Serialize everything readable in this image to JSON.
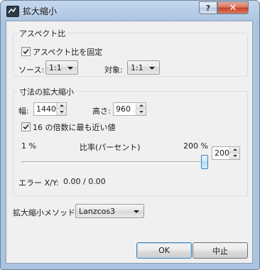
{
  "window": {
    "title": "拡大縮小"
  },
  "titlebar": {
    "help_glyph": "?",
    "close_glyph": "✕"
  },
  "aspect": {
    "group_title": "アスペクト比",
    "fix_checkbox_label": "アスペクト比を固定",
    "fix_checked": true,
    "source_label": "ソース:",
    "source_value": "1:1",
    "target_label": "対象:",
    "target_value": "1:1"
  },
  "dimensions": {
    "group_title": "寸法の拡大縮小",
    "width_label": "幅:",
    "width_value": "1440",
    "height_label": "高さ:",
    "height_value": "960",
    "multiple_checkbox_label": "16 の倍数に最も近い値",
    "multiple_checked": true,
    "slider_min_label": "1 %",
    "slider_title": "比率(パーセント)",
    "slider_max_label": "200 %",
    "slider_fraction": 1.0,
    "ratio_value": "200",
    "error_label": "エラー X/Y:",
    "error_value": "0.00 / 0.00"
  },
  "method": {
    "label": "拡大縮小メソッド:",
    "value": "Lanzcos3"
  },
  "buttons": {
    "ok": "OK",
    "cancel": "中止"
  }
}
